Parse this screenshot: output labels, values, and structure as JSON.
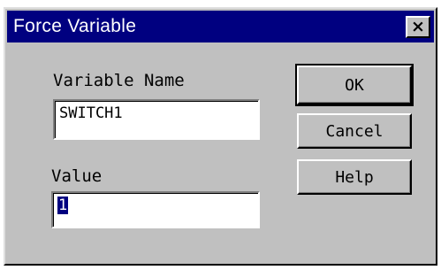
{
  "window": {
    "title": "Force Variable",
    "close_glyph": "×"
  },
  "form": {
    "variable_name_label": "Variable Name",
    "variable_name_value": "SWITCH1",
    "value_label": "Value",
    "value_value": "1"
  },
  "buttons": {
    "ok": "OK",
    "cancel": "Cancel",
    "help": "Help"
  },
  "colors": {
    "titlebar": "#000080",
    "face": "#c0c0c0",
    "selection": "#000080"
  }
}
